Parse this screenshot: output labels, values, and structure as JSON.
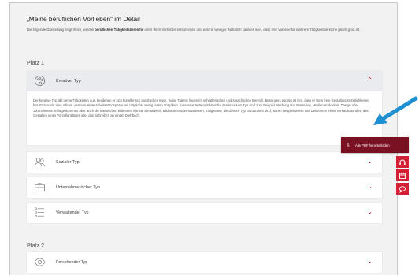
{
  "page": {
    "title": "„Meine beruflichen Vorlieben“ im Detail",
    "intro_prefix": "Die folgende Darstellung zeigt Ihnen, welche ",
    "intro_bold": "beruflichen Tätigkeitsbereiche",
    "intro_suffix": " mehr Ihren Vorlieben entsprechen und welche weniger. Natürlich kann es sein, dass Ihre Vorliebe für mehrere Tätigkeitsbereiche gleich groß ist."
  },
  "rank1": {
    "label": "Platz 1",
    "expanded": {
      "label": "Kreativer Typ",
      "icon": "palette-icon",
      "chevron": "chevron-up-icon",
      "text": "Der kreative Typ übt gerne Tätigkeiten aus, bei denen er sich künstlerisch ausdrücken kann. Seine Talente liegen im schöpferischen und sprachlichen Bereich. Besonders wichtig ist ihm, dass er stets freie Gestaltungsmöglichkeiten hat. Er braucht eine offene, unstrukturierte Arbeitsatmosphäre mit möglichst wenig festen Vorgaben. Interessante Berufsfelder für den kreativen Typ sind zum Beispiel Werbung und Marketing, Medienproduktion, Design oder Journalismus. Infrage kommen aber auch die klassischen bildenden Künste wie Malerei, Bildhauerei oder Musizieren. Tätigkeiten, die diesem Typ zuzuordnen sind, wären beispielsweise das Dekorieren eines Verkaufsstandes, das Gestalten eines Porzellanstücks oder das Schreiben an einem Drehbuch."
    },
    "items": [
      {
        "label": "Sozialer Typ",
        "icon": "people-icon"
      },
      {
        "label": "Unternehmerischer Typ",
        "icon": "briefcase-icon"
      },
      {
        "label": "Verwaltender Typ",
        "icon": "list-icon"
      }
    ]
  },
  "rank2": {
    "label": "Platz 2",
    "items": [
      {
        "label": "Forschender Typ",
        "icon": "eye-icon"
      }
    ]
  },
  "download_button": {
    "label": "Alle PDF herunterladen",
    "icon": "download-icon"
  },
  "side_buttons": [
    {
      "icon": "headset-icon"
    },
    {
      "icon": "calendar-icon"
    },
    {
      "icon": "chat-bubble-icon"
    }
  ],
  "colors": {
    "accent": "#c0122b",
    "download_bg": "#7a1122",
    "side_bg": "#d42034",
    "arrow": "#1e8fd0"
  }
}
